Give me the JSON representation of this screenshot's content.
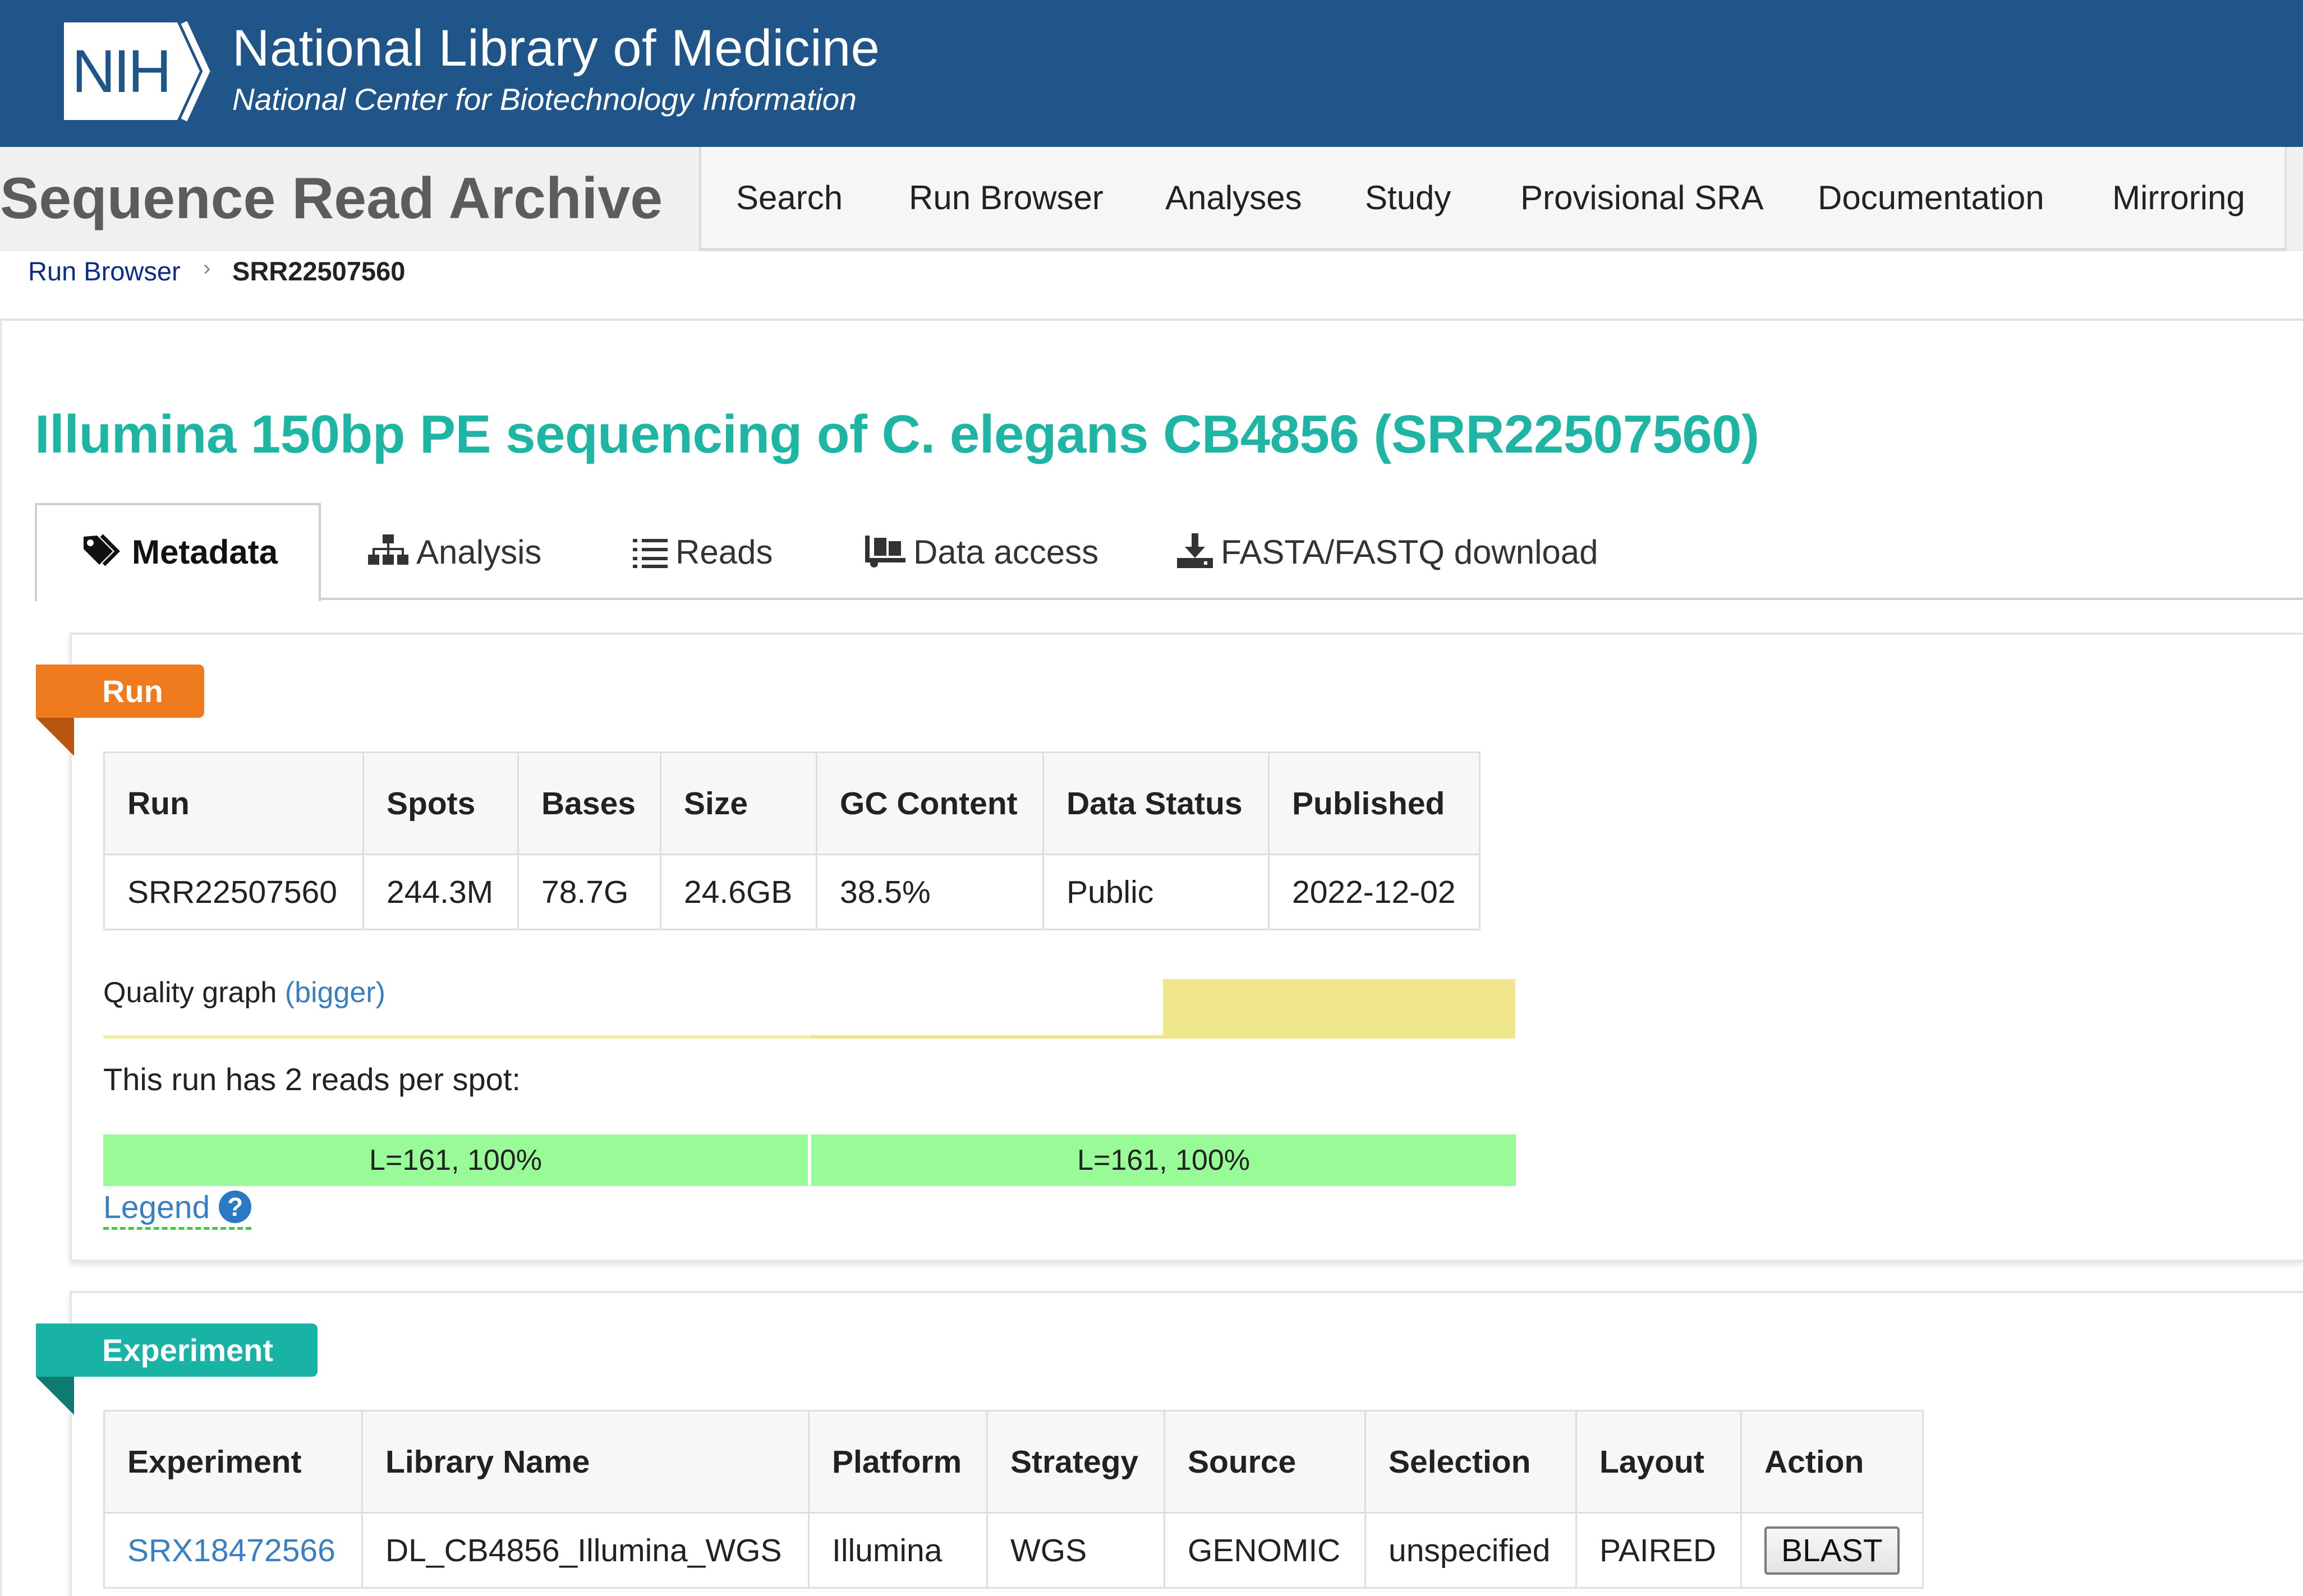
{
  "header": {
    "logo_text": "NIH",
    "title": "National Library of Medicine",
    "subtitle": "National Center for Biotechnology Information",
    "bg_color": "#20558a"
  },
  "sra": {
    "title": "Sequence Read Archive",
    "nav": [
      "Search",
      "Run Browser",
      "Analyses",
      "Study",
      "Provisional SRA",
      "Documentation",
      "Mirroring"
    ]
  },
  "breadcrumb": {
    "link": "Run Browser",
    "separator": "›",
    "current": "SRR22507560"
  },
  "page_title": "Illumina 150bp PE sequencing of C. elegans CB4856 (SRR22507560)",
  "tabs": [
    {
      "label": "Metadata",
      "icon": "tags-icon",
      "active": true
    },
    {
      "label": "Analysis",
      "icon": "sitemap-icon",
      "active": false
    },
    {
      "label": "Reads",
      "icon": "list-icon",
      "active": false
    },
    {
      "label": "Data access",
      "icon": "dolly-icon",
      "active": false
    },
    {
      "label": "FASTA/FASTQ download",
      "icon": "download-icon",
      "active": false
    }
  ],
  "run_section": {
    "ribbon": "Run",
    "ribbon_color": "#f07b1f",
    "headers": [
      "Run",
      "Spots",
      "Bases",
      "Size",
      "GC Content",
      "Data Status",
      "Published"
    ],
    "row": [
      "SRR22507560",
      "244.3M",
      "78.7G",
      "24.6GB",
      "38.5%",
      "Public",
      "2022-12-02"
    ],
    "quality_label": "Quality graph",
    "quality_link": "(bigger)",
    "reads_text": "This run has 2 reads per spot:",
    "reads": [
      {
        "label": "L=161, 100%",
        "fraction": 1.0
      },
      {
        "label": "L=161, 100%",
        "fraction": 1.0
      }
    ],
    "read_color": "#98fb98",
    "legend": "Legend",
    "legend_help": "?"
  },
  "experiment_section": {
    "ribbon": "Experiment",
    "ribbon_color": "#18b3a4",
    "headers": [
      "Experiment",
      "Library Name",
      "Platform",
      "Strategy",
      "Source",
      "Selection",
      "Layout",
      "Action"
    ],
    "row": [
      "SRX18472566",
      "DL_CB4856_Illumina_WGS",
      "Illumina",
      "WGS",
      "GENOMIC",
      "unspecified",
      "PAIRED"
    ],
    "action": "BLAST"
  }
}
